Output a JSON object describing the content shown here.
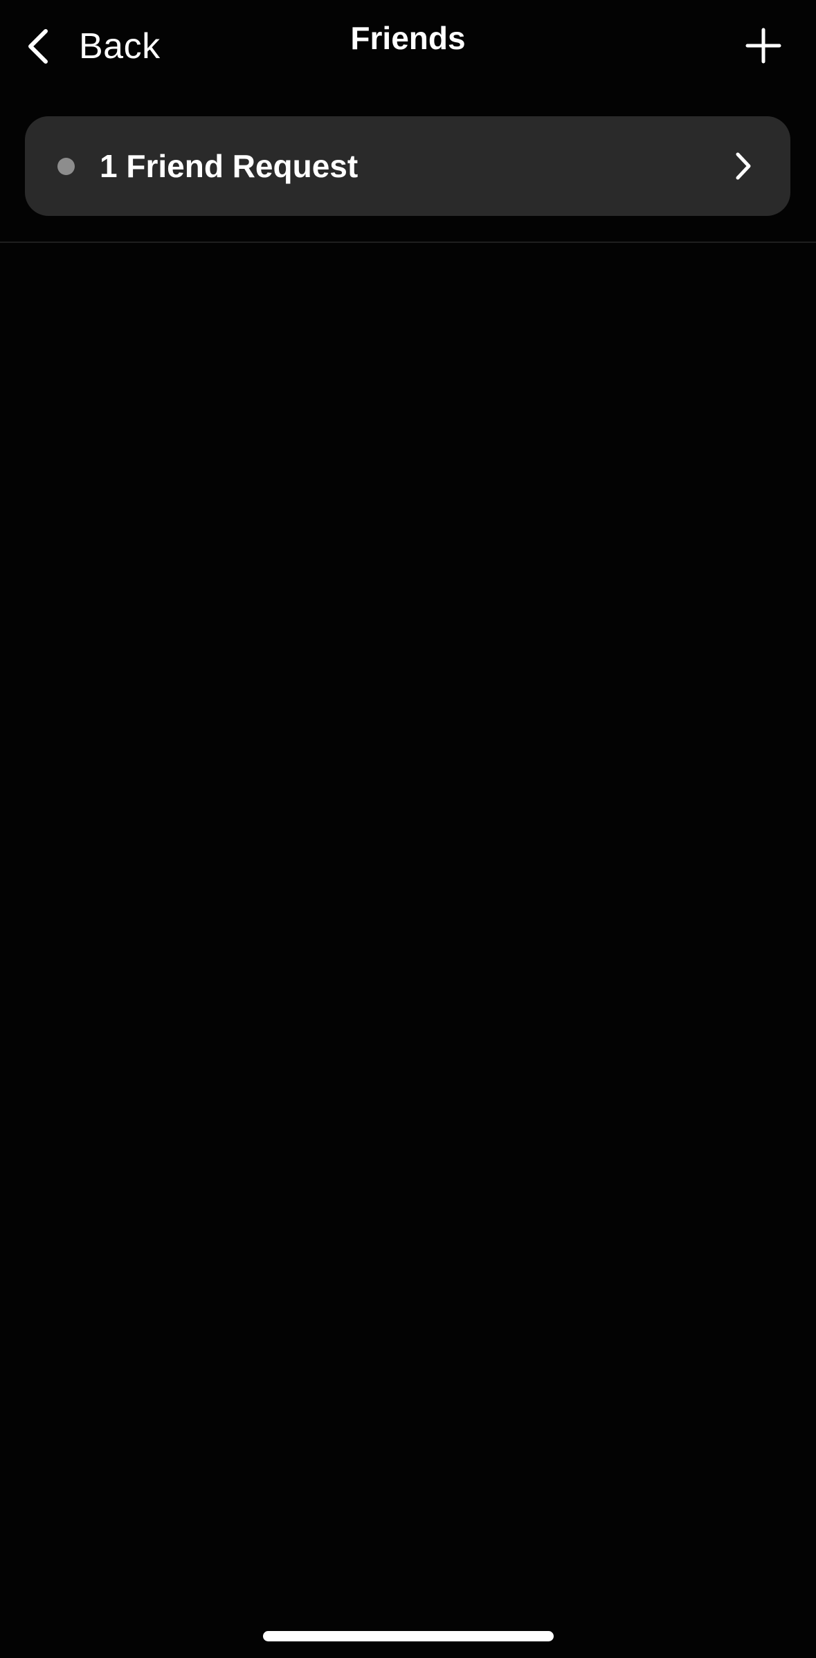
{
  "nav": {
    "back_label": "Back",
    "title": "Friends",
    "back_icon": "chevron-left-icon",
    "add_icon": "plus-icon"
  },
  "friend_requests": {
    "label": "1 Friend Request",
    "count": 1,
    "dot_color": "#8d8d8d",
    "chevron_icon": "chevron-right-icon"
  },
  "colors": {
    "background": "#030303",
    "card": "#2a2a2a",
    "text": "#ffffff"
  }
}
